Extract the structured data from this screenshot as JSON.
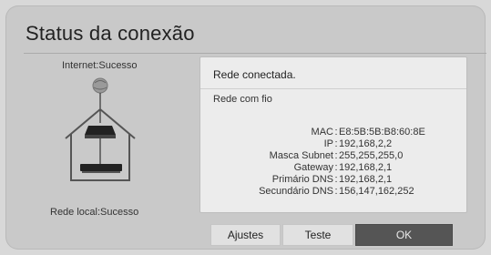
{
  "title": "Status da conexão",
  "left": {
    "internet_status": "Internet:Sucesso",
    "local_status": "Rede local:Sucesso"
  },
  "info": {
    "connected": "Rede conectada.",
    "type": "Rede com fio",
    "rows": [
      {
        "label": "MAC",
        "value": "E8:5B:5B:B8:60:8E"
      },
      {
        "label": "IP",
        "value": "192,168,2,2"
      },
      {
        "label": "Masca Subnet",
        "value": "255,255,255,0"
      },
      {
        "label": "Gateway",
        "value": "192,168,2,1"
      },
      {
        "label": "Primário DNS",
        "value": "192,168,2,1"
      },
      {
        "label": "Secundário DNS",
        "value": "156,147,162,252"
      }
    ]
  },
  "buttons": {
    "adjust": "Ajustes",
    "test": "Teste",
    "ok": "OK"
  },
  "colors": {
    "panel_bg": "#c9c9c9",
    "info_bg": "#ececec",
    "ok_bg": "#555555"
  }
}
